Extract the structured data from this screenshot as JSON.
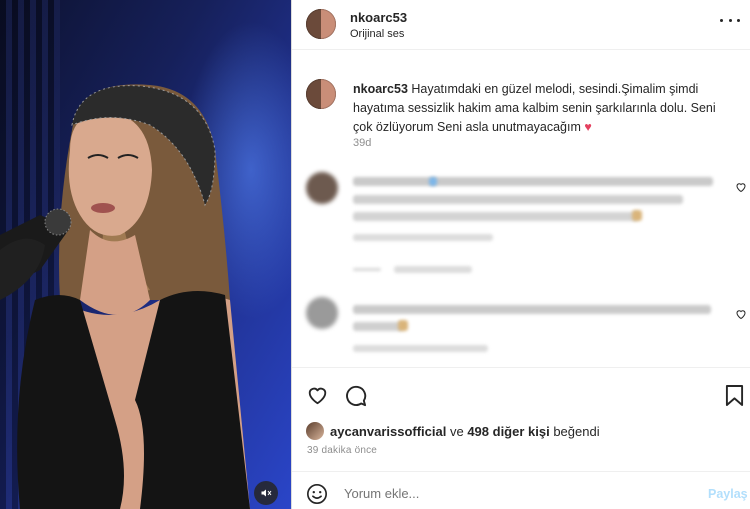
{
  "post": {
    "author": "nkoarc53",
    "audio": "Orijinal ses"
  },
  "caption": {
    "username": "nkoarc53",
    "text": " Hayatımdaki en güzel melodi, sesindi.Şimalim şimdi hayatıma sessizlik hakim ama kalbim senin şarkılarınla dolu. Seni çok özlüyorum Seni asla unutmayacağım ",
    "emoji": "♥",
    "age": "39d"
  },
  "likes": {
    "first_liker": "aycanvarissofficial",
    "connector": " ve ",
    "others": "498 diğer kişi",
    "suffix": " beğendi"
  },
  "posted_ago": "39 dakika önce",
  "comment_box": {
    "placeholder": "Yorum ekle...",
    "share_label": "Paylaş"
  },
  "icons": {
    "more": "more-options-icon",
    "like": "heart-icon",
    "comment": "comment-icon",
    "save": "bookmark-icon",
    "emoji": "emoji-icon",
    "mute": "speaker-muted-icon"
  },
  "colors": {
    "text": "#262626",
    "secondary": "#8e8e8e",
    "share_disabled": "#b2dffc",
    "heart": "#e4405f"
  }
}
